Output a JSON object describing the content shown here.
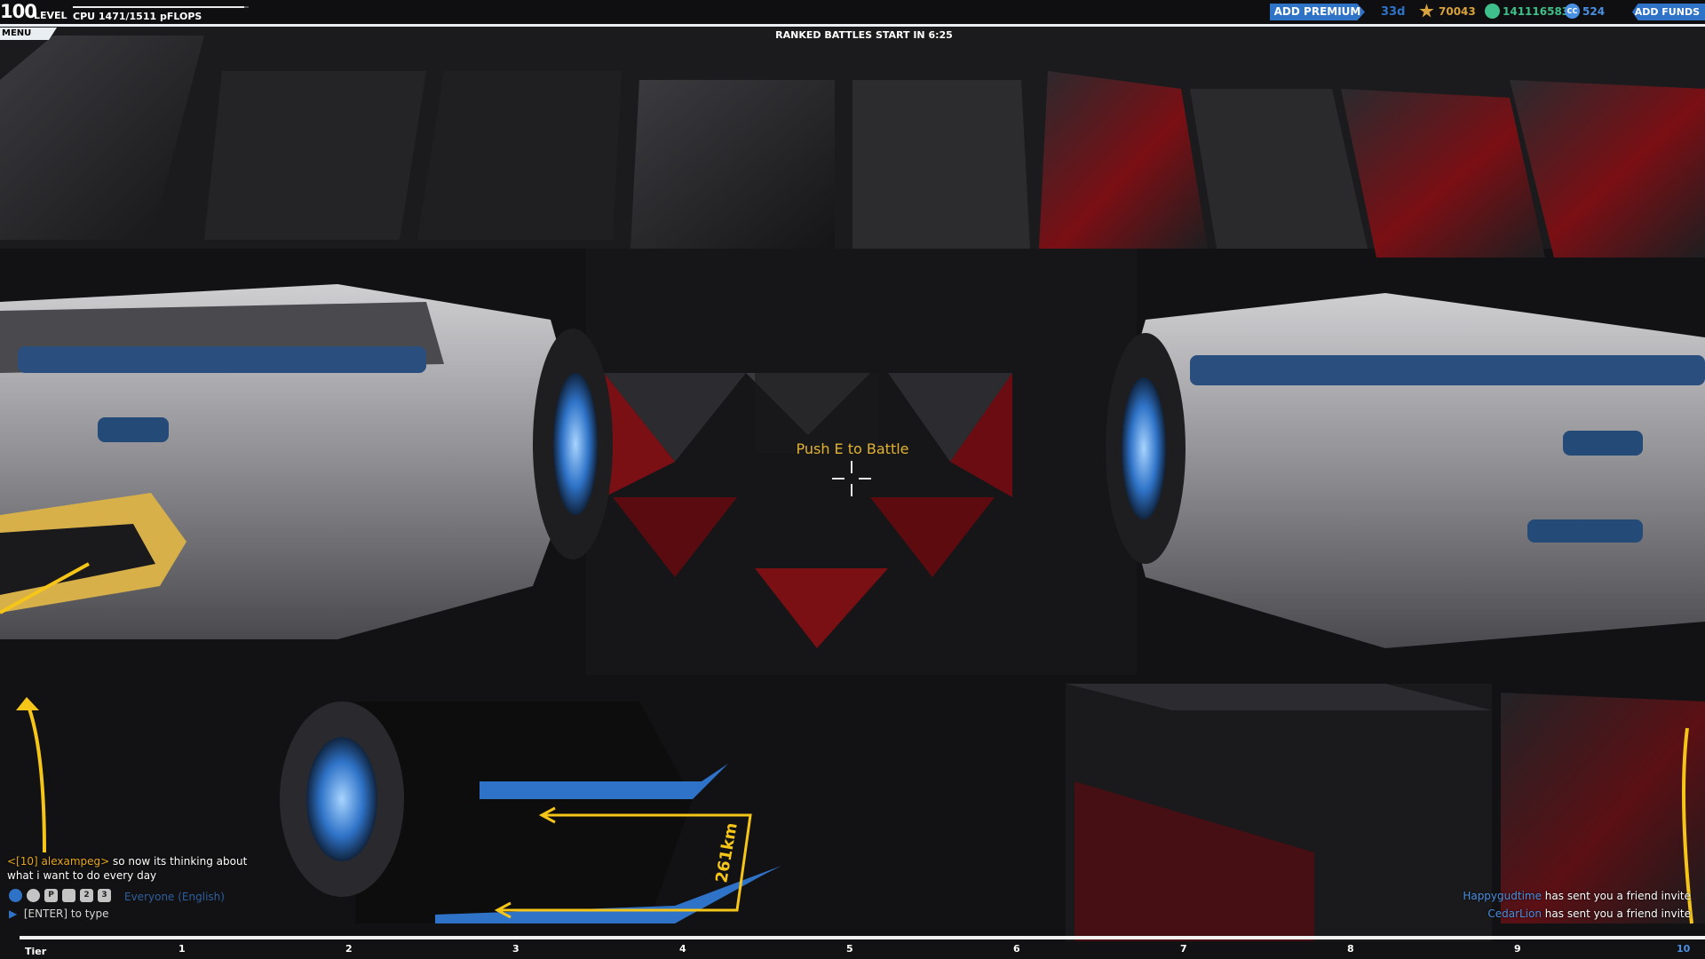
{
  "hud": {
    "level_number": "100",
    "level_label": "LEVEL",
    "cpu_text": "CPU 1471/1511 pFLOPS",
    "cpu_fraction": 0.974,
    "menu_label": "MENU [TAB]",
    "ranked_text": "RANKED BATTLES START IN  6:25",
    "premium_button": "ADD PREMIUM",
    "premium_days": "33d",
    "rp_value": "70043",
    "robits_value": "141116583",
    "cc_icon": "CC",
    "cc_value": "524",
    "funds_button": "ADD FUNDS"
  },
  "center": {
    "battle_prompt": "Push E to Battle"
  },
  "garage_floor": {
    "marking": "261km"
  },
  "chat": {
    "message_user": "<[10] alexampeg>",
    "message_text_1": " so now its thinking about",
    "message_text_2": "what i want to do every day",
    "channel": "Everyone (English)",
    "input_hint": "[ENTER] to type",
    "icons": [
      "globe-icon",
      "globe-dark-icon",
      "party-icon",
      "friend-icon",
      "friend-2-icon",
      "friend-3-icon"
    ],
    "icon_labels": [
      "",
      "",
      "P",
      "",
      "2",
      "3"
    ]
  },
  "notifications": [
    {
      "name": "Happygudtime",
      "text": " has sent you a friend invite"
    },
    {
      "name": "CedarLion",
      "text": " has sent you a friend invite"
    }
  ],
  "tier": {
    "label": "Tier",
    "ticks": [
      "1",
      "2",
      "3",
      "4",
      "5",
      "6",
      "7",
      "8",
      "9",
      "10"
    ]
  },
  "colors": {
    "accent_blue": "#2f73c8",
    "prompt_yellow": "#e2b233",
    "floor_yellow": "#f5c518",
    "robits_green": "#3fbf8a"
  }
}
